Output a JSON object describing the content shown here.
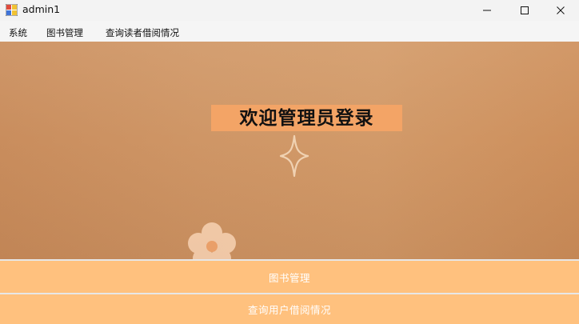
{
  "window": {
    "title": "admin1"
  },
  "menu": {
    "items": [
      {
        "label": "系统"
      },
      {
        "label": "图书管理"
      },
      {
        "label": "查询读者借阅情况"
      }
    ]
  },
  "main": {
    "welcome_text": "欢迎管理员登录"
  },
  "buttons": {
    "book_management": "图书管理",
    "query_borrowing": "查询用户借阅情况"
  },
  "colors": {
    "background_tan": "#cf9666",
    "welcome_bg": "#f3a466",
    "button_bg": "#ffc17e",
    "button_text": "#ffffff"
  },
  "icons": {
    "app": "app-icon",
    "minimize": "minimize-icon",
    "maximize": "maximize-icon",
    "close": "close-icon",
    "sparkle": "sparkle-icon",
    "flower": "flower-icon"
  }
}
